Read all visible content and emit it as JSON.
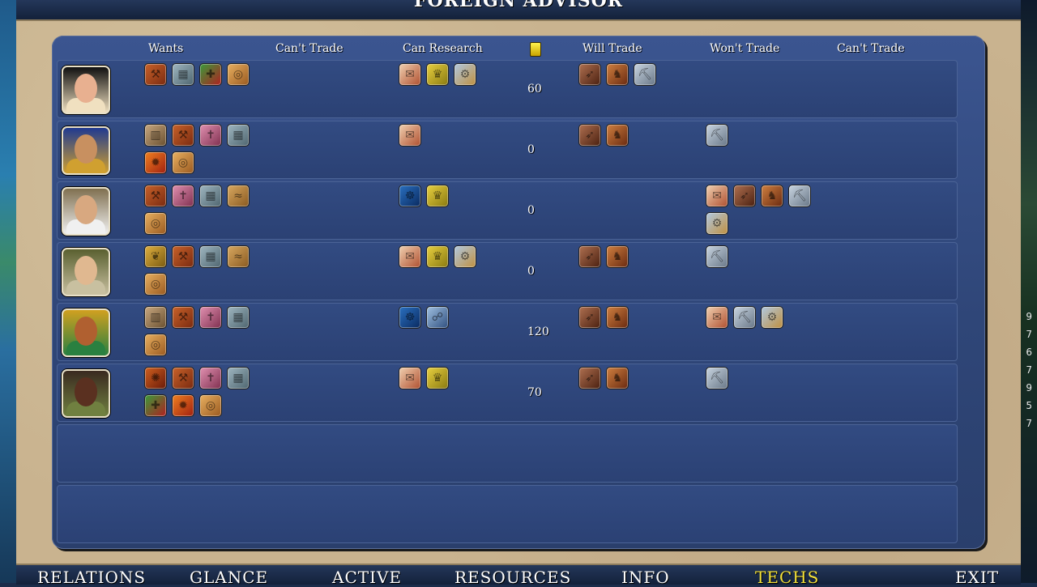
{
  "title": "FOREIGN ADVISOR",
  "headers": {
    "wants": "Wants",
    "cant_trade_1": "Can't Trade",
    "can_research": "Can Research",
    "will_trade": "Will Trade",
    "wont_trade": "Won't Trade",
    "cant_trade_2": "Can't Trade"
  },
  "rows": [
    {
      "leader": "leader-1",
      "gold": "60",
      "wants": [
        "bronze-working",
        "masonry",
        "mathematics",
        "sailing"
      ],
      "can_research": [
        "writing",
        "monarchy",
        "the-wheel"
      ],
      "will_trade": [
        "hunting",
        "horseback-riding",
        "mining"
      ],
      "wont_trade": []
    },
    {
      "leader": "leader-2",
      "gold": "0",
      "wants": [
        "pottery",
        "bronze-working",
        "priesthood",
        "masonry",
        "archery",
        "sailing"
      ],
      "can_research": [
        "writing"
      ],
      "will_trade": [
        "hunting",
        "horseback-riding"
      ],
      "wont_trade": [
        "mining"
      ]
    },
    {
      "leader": "leader-3",
      "gold": "0",
      "wants": [
        "bronze-working",
        "priesthood",
        "masonry",
        "fishing",
        "sailing"
      ],
      "can_research": [
        "meditation",
        "monarchy"
      ],
      "will_trade": [],
      "wont_trade": [
        "writing",
        "hunting",
        "horseback-riding",
        "mining",
        "the-wheel"
      ]
    },
    {
      "leader": "leader-4",
      "gold": "0",
      "wants": [
        "agriculture",
        "bronze-working",
        "masonry",
        "fishing",
        "sailing"
      ],
      "can_research": [
        "writing",
        "monarchy",
        "the-wheel"
      ],
      "will_trade": [
        "hunting",
        "horseback-riding"
      ],
      "wont_trade": [
        "mining"
      ]
    },
    {
      "leader": "leader-5",
      "gold": "120",
      "wants": [
        "pottery",
        "bronze-working",
        "priesthood",
        "masonry",
        "sailing"
      ],
      "can_research": [
        "meditation",
        "polytheism"
      ],
      "will_trade": [
        "hunting",
        "horseback-riding"
      ],
      "wont_trade": [
        "writing",
        "mining",
        "the-wheel"
      ]
    },
    {
      "leader": "leader-6",
      "gold": "70",
      "wants": [
        "mysticism",
        "bronze-working",
        "priesthood",
        "masonry",
        "mathematics",
        "archery",
        "sailing"
      ],
      "can_research": [
        "writing",
        "monarchy"
      ],
      "will_trade": [
        "hunting",
        "horseback-riding"
      ],
      "wont_trade": [
        "mining"
      ]
    }
  ],
  "nav": {
    "relations": "RELATIONS",
    "glance": "GLANCE",
    "active": "ACTIVE",
    "resources": "RESOURCES",
    "info": "INFO",
    "techs": "TECHS",
    "exit": "EXIT"
  },
  "map_numbers": [
    "9",
    "7",
    "6",
    "7",
    "9",
    "5",
    "7"
  ],
  "colors": {
    "active_tab": "#f4e23a",
    "panel": "#2f4678"
  }
}
